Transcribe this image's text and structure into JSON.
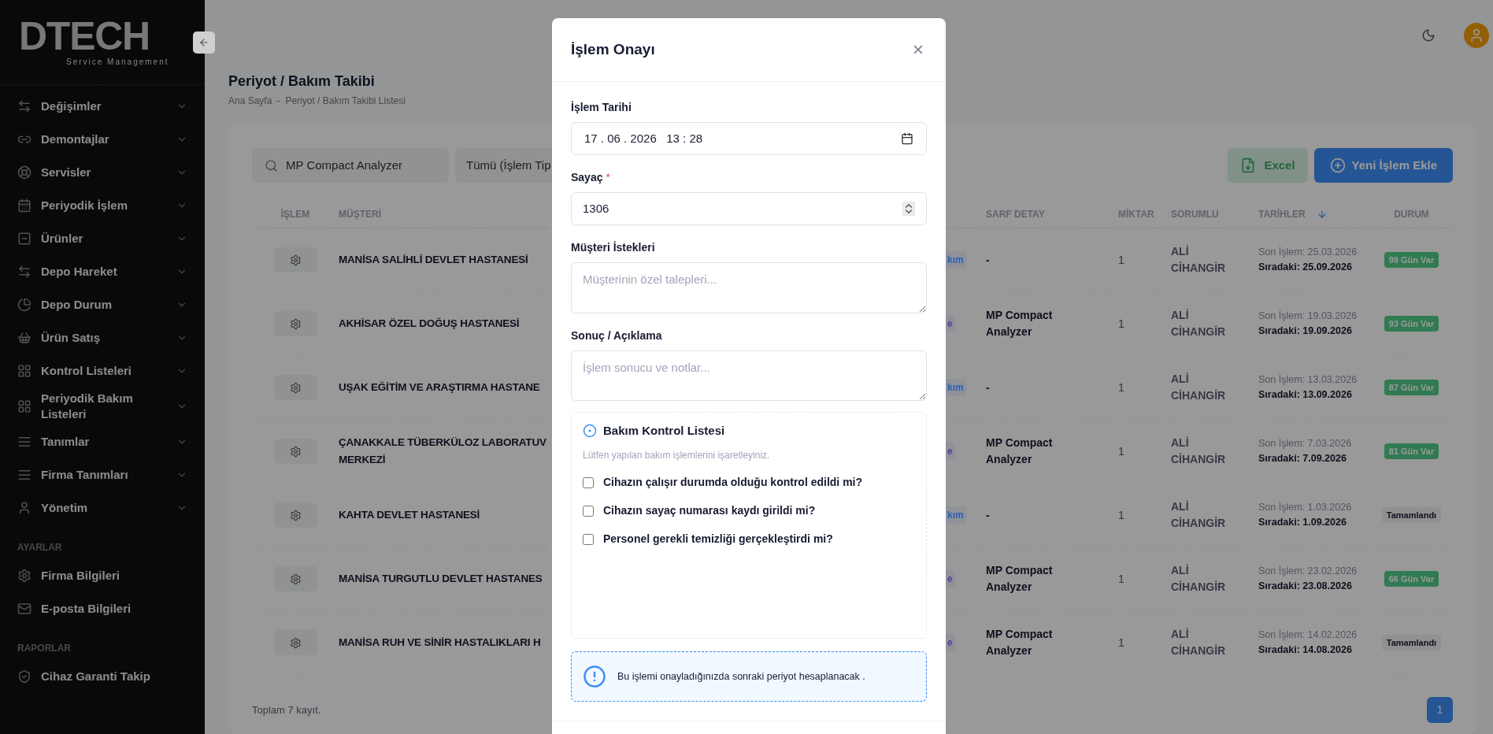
{
  "logo": {
    "name": "DTECH",
    "tagline": "Service Management"
  },
  "sidebar": {
    "items": [
      {
        "label": "Değişimler",
        "expanded": false
      },
      {
        "label": "Demontajlar",
        "expanded": false
      },
      {
        "label": "Servisler",
        "expanded": false
      },
      {
        "label": "Periyodik İşlem",
        "expanded": false
      },
      {
        "label": "Ürünler",
        "expanded": false
      },
      {
        "label": "Depo Hareket",
        "expanded": false
      },
      {
        "label": "Depo Durum",
        "expanded": false
      },
      {
        "label": "Ürün Satış",
        "expanded": false
      },
      {
        "label": "Kontrol Listeleri",
        "expanded": false
      },
      {
        "label": "Periyodik Bakım Listeleri",
        "expanded": false
      },
      {
        "label": "Tanımlar",
        "expanded": false
      },
      {
        "label": "Firma Tanımları",
        "expanded": false
      },
      {
        "label": "Yönetim",
        "expanded": false
      }
    ],
    "sections": [
      {
        "heading": "AYARLAR",
        "items": [
          "Firma Bilgileri",
          "E-posta Bilgileri"
        ]
      },
      {
        "heading": "RAPORLAR",
        "items": [
          "Cihaz Garanti Takip"
        ]
      }
    ]
  },
  "page": {
    "title": "Periyot / Bakım Takibi",
    "breadcrumb": [
      "Ana Sayfa",
      "Periyot / Bakım Takibi Listesi"
    ]
  },
  "toolbar": {
    "search": "MP Compact Analyzer",
    "filter": "Tümü (İşlem Tip",
    "excel": "Excel",
    "add": "Yeni İşlem Ekle"
  },
  "table": {
    "columns": [
      "İŞLEM",
      "MÜŞTERİ",
      "SARF DETAY",
      "MİKTAR",
      "SORUMLU",
      "TARİHLER",
      "DURUM"
    ],
    "rows": [
      {
        "customer": [
          "MANİSA SALİHLİ DEVLET HASTANESİ"
        ],
        "column_3": "kım",
        "color": "#2f5fb0",
        "detail": "-",
        "qty": "1",
        "owner": "ALİ CİHANGİR",
        "last": "Son İşlem: 25.03.2026",
        "next": "Sıradaki: 25.09.2026",
        "status": "99 Gün Var",
        "kind": "days"
      },
      {
        "customer": [
          "AKHİSAR ÖZEL DOĞUŞ HASTANESİ"
        ],
        "column_3": "e",
        "color": "#5b3a9e",
        "detail": "MP Compact Analyzer",
        "qty": "1",
        "owner": "ALİ CİHANGİR",
        "last": "Son İşlem: 19.03.2026",
        "next": "Sıradaki: 19.09.2026",
        "status": "93 Gün Var",
        "kind": "days"
      },
      {
        "customer": [
          "UŞAK EĞİTİM VE ARAŞTIRMA HASTANE"
        ],
        "column_3": "kım",
        "color": "#2f5fb0",
        "detail": "-",
        "qty": "1",
        "owner": "ALİ CİHANGİR",
        "last": "Son İşlem: 13.03.2026",
        "next": "Sıradaki: 13.09.2026",
        "status": "87 Gün Var",
        "kind": "days"
      },
      {
        "customer": [
          "ÇANAKKALE TÜBERKÜLOZ LABORATUV",
          "MERKEZİ"
        ],
        "column_3": "e",
        "color": "#5b3a9e",
        "detail": "MP Compact Analyzer",
        "qty": "1",
        "owner": "ALİ CİHANGİR",
        "last": "Son İşlem: 7.03.2026",
        "next": "Sıradaki: 7.09.2026",
        "status": "81 Gün Var",
        "kind": "days"
      },
      {
        "customer": [
          "KAHTA DEVLET HASTANESİ"
        ],
        "column_3": "kım",
        "color": "#2f5fb0",
        "detail": "-",
        "qty": "1",
        "owner": "ALİ CİHANGİR",
        "last": "Son İşlem: 1.03.2026",
        "next": "Sıradaki: 1.09.2026",
        "status": "Tamamlandı",
        "kind": "done"
      },
      {
        "customer": [
          "MANİSA TURGUTLU DEVLET HASTANES"
        ],
        "column_3": "e",
        "color": "#5b3a9e",
        "detail": "MP Compact Analyzer",
        "qty": "1",
        "owner": "ALİ CİHANGİR",
        "last": "Son İşlem: 23.02.2026",
        "next": "Sıradaki: 23.08.2026",
        "status": "66 Gün Var",
        "kind": "days"
      },
      {
        "customer": [
          "MANİSA RUH VE SİNİR HASTALIKLARI H"
        ],
        "column_3": "e",
        "color": "#5b3a9e",
        "detail": "MP Compact Analyzer",
        "qty": "1",
        "owner": "ALİ CİHANGİR",
        "last": "Son İşlem: 14.02.2026",
        "next": "Sıradaki: 14.08.2026",
        "status": "Tamamlandı",
        "kind": "done"
      }
    ]
  },
  "footer": {
    "total": "Toplam 7 kayıt.",
    "pages": [
      {
        "label": "1",
        "selected": true
      }
    ]
  },
  "modal": {
    "title": "İşlem Onayı",
    "close": "×",
    "date": {
      "label": "İşlem Tarihi",
      "value": "17 . 06 . 2026   13 : 28"
    },
    "counter": {
      "label": "Sayaç",
      "required": "*",
      "value": "1306"
    },
    "requests": {
      "label": "Müşteri İstekleri",
      "placeholder": "Müşterinin özel talepleri..."
    },
    "result": {
      "label": "Sonuç / Açıklama",
      "placeholder": "İşlem sonucu ve notlar..."
    },
    "checklist": {
      "title": "Bakım Kontrol Listesi",
      "hint": "Lütfen yapılan bakım işlemlerini işaretleyiniz.",
      "items": [
        {
          "label": "Cihazın çalışır durumda olduğu kontrol edildi mi?",
          "checked": false
        },
        {
          "label": "Cihazın sayaç numarası kaydı girildi mi?",
          "checked": false
        },
        {
          "label": "Personel gerekli temizliği gerçekleştirdi mi?",
          "checked": false
        }
      ]
    },
    "info": "Bu işlemi onayladığınızda sonraki periyot hesaplanacak ."
  }
}
